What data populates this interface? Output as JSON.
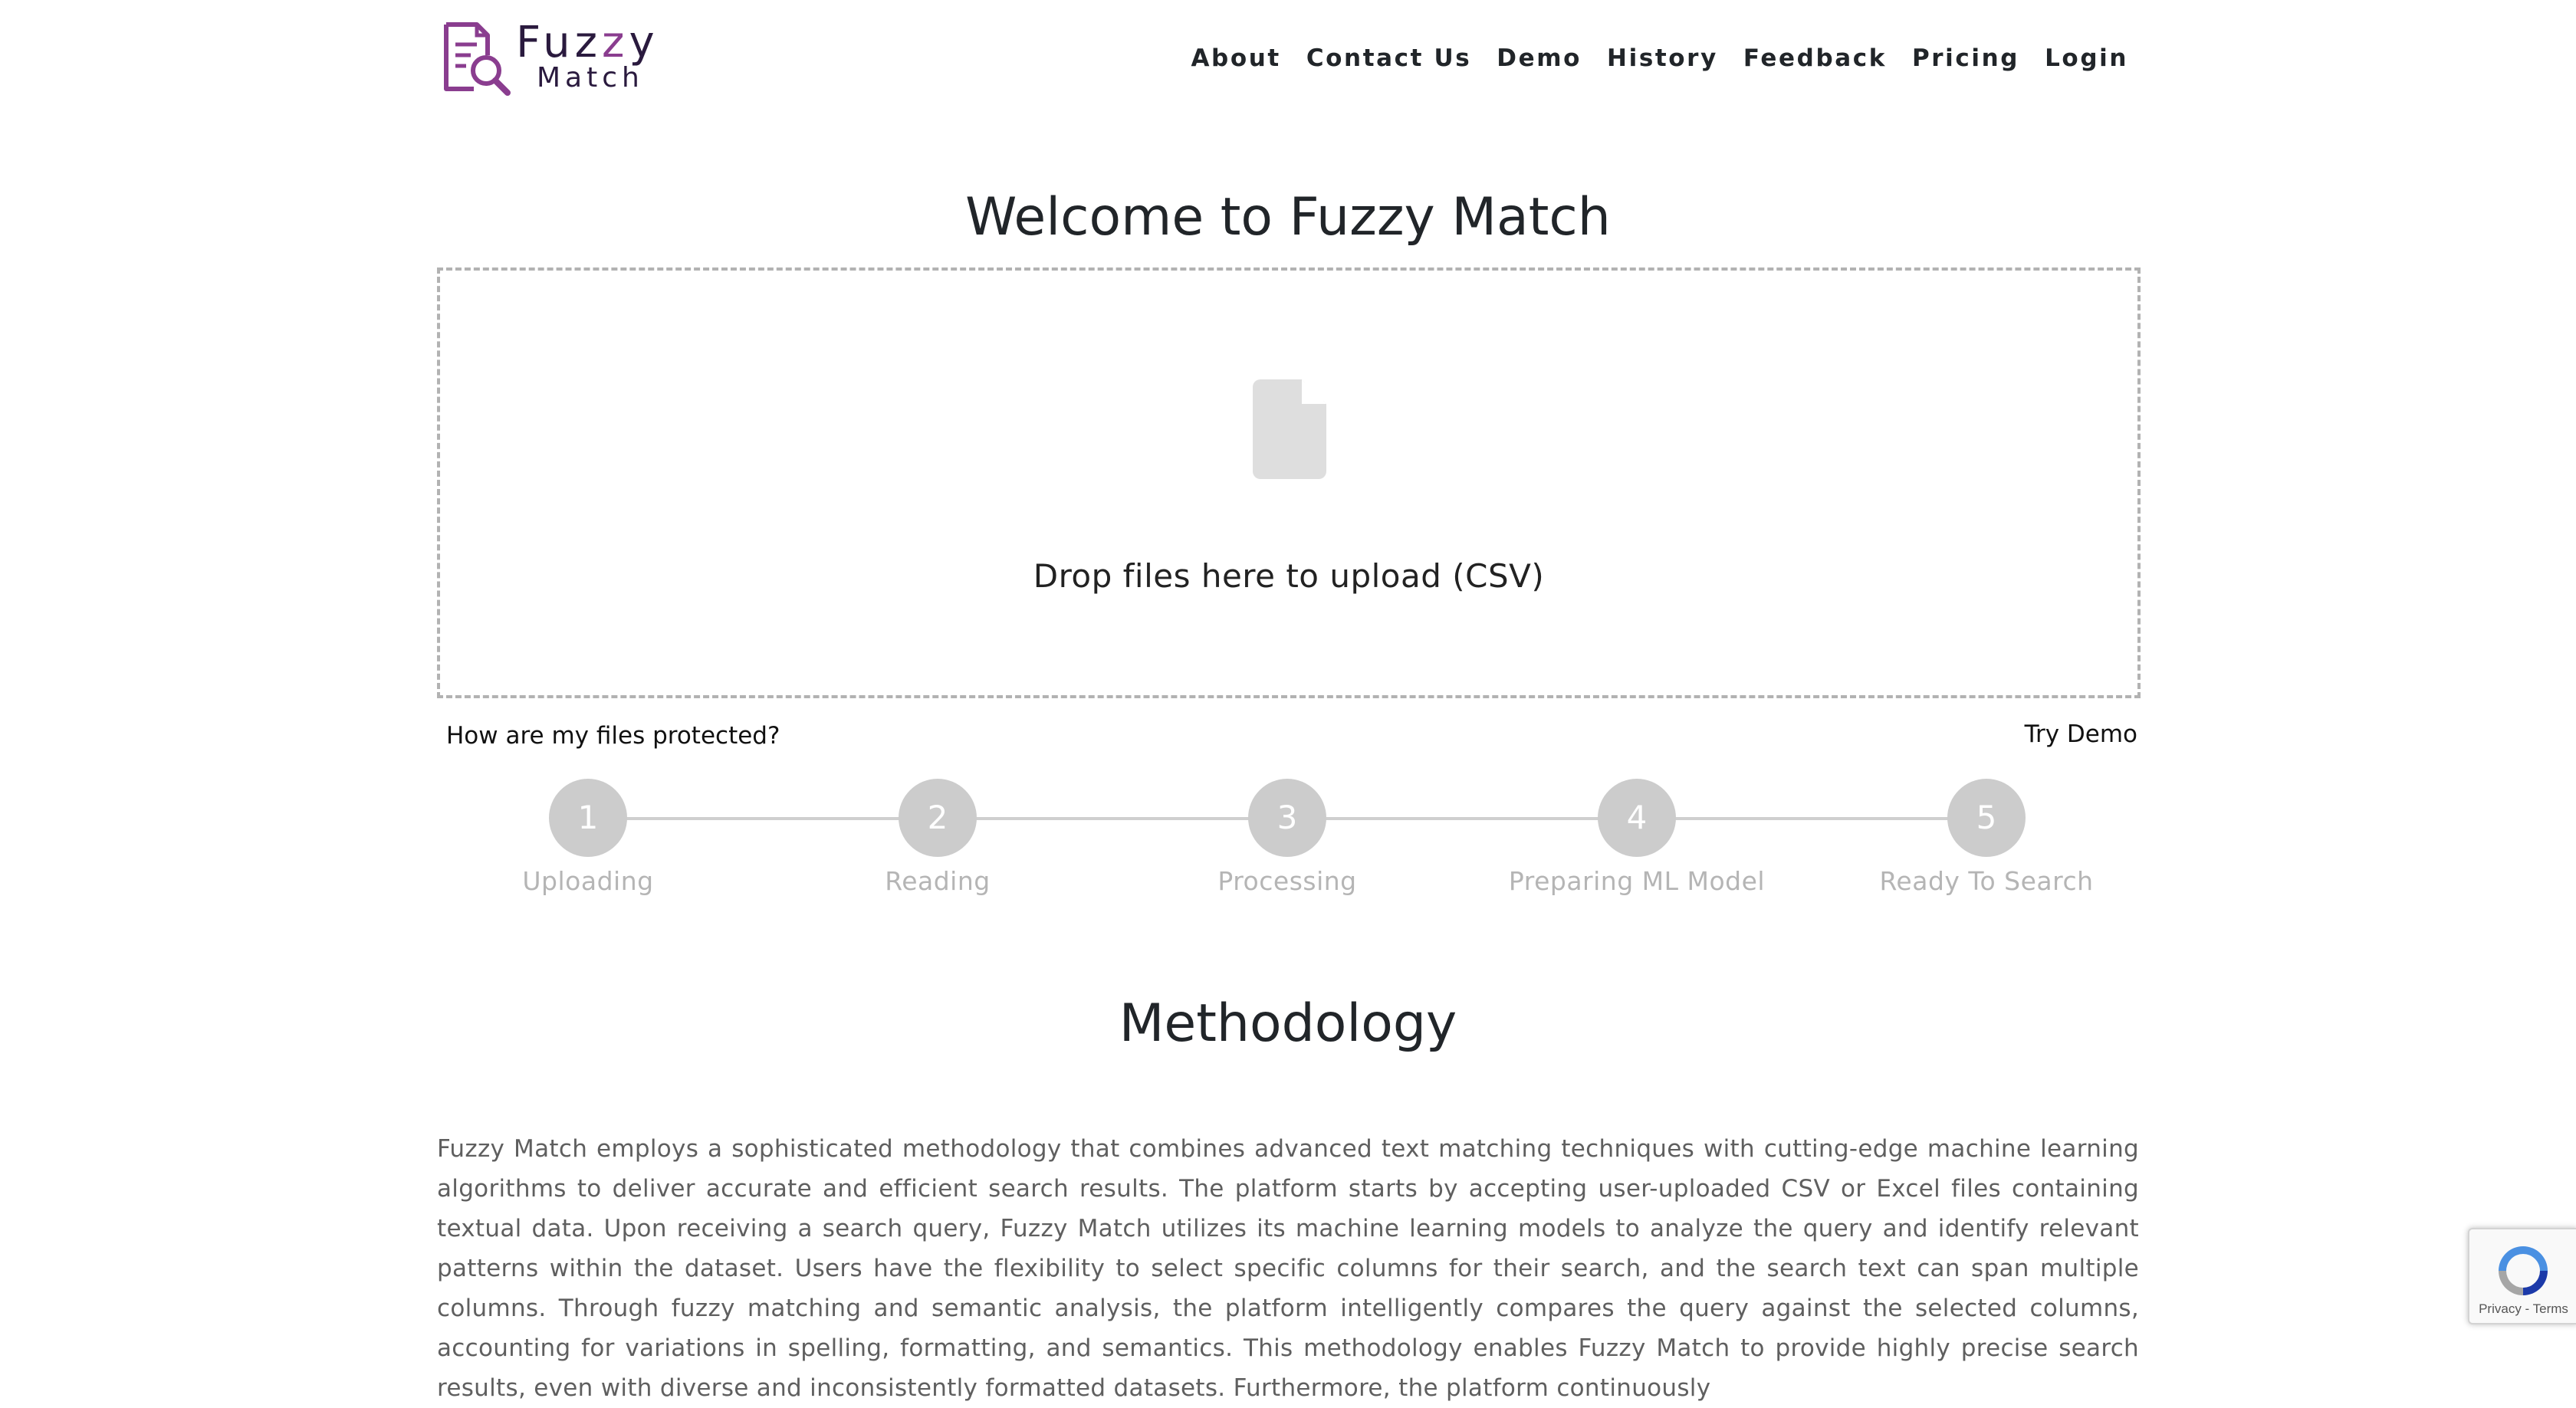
{
  "logo": {
    "line1_prefix": "Fuz",
    "line1_accent": "z",
    "line1_suffix": "y",
    "line2": "Match"
  },
  "nav": {
    "items": [
      "About",
      "Contact Us",
      "Demo",
      "History",
      "Feedback",
      "Pricing",
      "Login"
    ]
  },
  "page_title": "Welcome to Fuzzy Match",
  "dropzone": {
    "text": "Drop files here to upload (CSV)",
    "icon": "file-icon"
  },
  "links": {
    "protect": "How are my files protected?",
    "demo": "Try Demo"
  },
  "steps": [
    {
      "number": "1",
      "label": "Uploading"
    },
    {
      "number": "2",
      "label": "Reading"
    },
    {
      "number": "3",
      "label": "Processing"
    },
    {
      "number": "4",
      "label": "Preparing ML Model"
    },
    {
      "number": "5",
      "label": "Ready To Search"
    }
  ],
  "methodology": {
    "title": "Methodology",
    "text": "Fuzzy Match employs a sophisticated methodology that combines advanced text matching techniques with cutting-edge machine learning algorithms to deliver accurate and efficient search results. The platform starts by accepting user-uploaded CSV or Excel files containing textual data. Upon receiving a search query, Fuzzy Match utilizes its machine learning models to analyze the query and identify relevant patterns within the dataset. Users have the flexibility to select specific columns for their search, and the search text can span multiple columns. Through fuzzy matching and semantic analysis, the platform intelligently compares the query against the selected columns, accounting for variations in spelling, formatting, and semantics. This methodology enables Fuzzy Match to provide highly precise search results, even with diverse and inconsistently formatted datasets. Furthermore, the platform continuously"
  },
  "recaptcha": {
    "text": "Privacy - Terms"
  },
  "colors": {
    "accent": "#8a3d8f",
    "step_circle": "#cccccc",
    "step_label": "#b5b5b5"
  }
}
